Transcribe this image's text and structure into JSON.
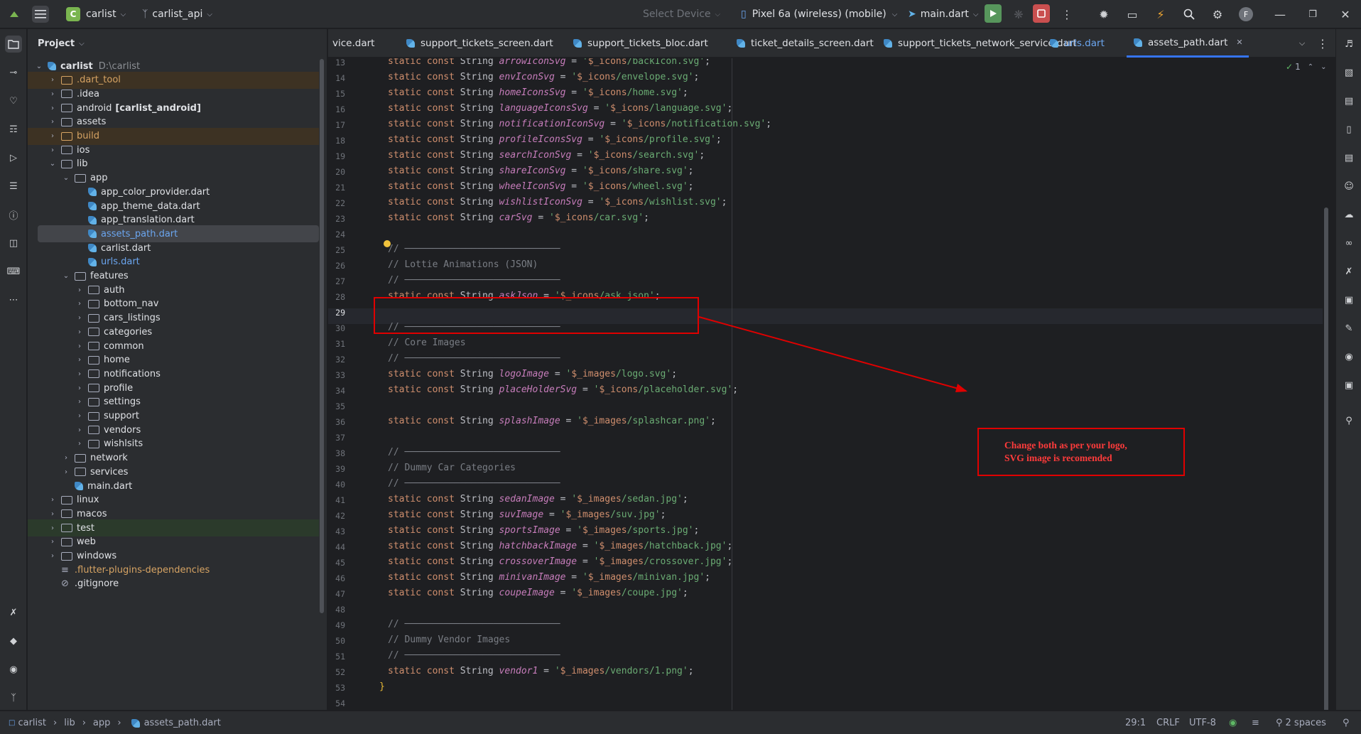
{
  "titlebar": {
    "project_badge": "C",
    "project_name": "carlist",
    "vcs_branch": "carlist_api",
    "select_device": "Select Device",
    "device": "Pixel 6a (wireless) (mobile)",
    "run_config": "main.dart",
    "avatar_letter": "F"
  },
  "project_panel": {
    "title": "Project",
    "tree": [
      {
        "label": "carlist",
        "extra": "D:\\carlist",
        "depth": 0,
        "kind": "module",
        "open": true
      },
      {
        "label": ".dart_tool",
        "depth": 1,
        "kind": "folder",
        "color": "orange",
        "hl": "orange"
      },
      {
        "label": ".idea",
        "depth": 1,
        "kind": "folder"
      },
      {
        "label": "android",
        "extra": "[carlist_android]",
        "depth": 1,
        "kind": "folder"
      },
      {
        "label": "assets",
        "depth": 1,
        "kind": "folder"
      },
      {
        "label": "build",
        "depth": 1,
        "kind": "folder",
        "color": "orange",
        "hl": "orange"
      },
      {
        "label": "ios",
        "depth": 1,
        "kind": "folder"
      },
      {
        "label": "lib",
        "depth": 1,
        "kind": "folder",
        "open": true
      },
      {
        "label": "app",
        "depth": 2,
        "kind": "folder",
        "open": true
      },
      {
        "label": "app_color_provider.dart",
        "depth": 3,
        "kind": "dart"
      },
      {
        "label": "app_theme_data.dart",
        "depth": 3,
        "kind": "dart"
      },
      {
        "label": "app_translation.dart",
        "depth": 3,
        "kind": "dart"
      },
      {
        "label": "assets_path.dart",
        "depth": 3,
        "kind": "dart",
        "color": "blue",
        "selected": true
      },
      {
        "label": "carlist.dart",
        "depth": 3,
        "kind": "dart"
      },
      {
        "label": "urls.dart",
        "depth": 3,
        "kind": "dart",
        "color": "blue"
      },
      {
        "label": "features",
        "depth": 2,
        "kind": "folder",
        "open": true
      },
      {
        "label": "auth",
        "depth": 3,
        "kind": "folder"
      },
      {
        "label": "bottom_nav",
        "depth": 3,
        "kind": "folder"
      },
      {
        "label": "cars_listings",
        "depth": 3,
        "kind": "folder"
      },
      {
        "label": "categories",
        "depth": 3,
        "kind": "folder"
      },
      {
        "label": "common",
        "depth": 3,
        "kind": "folder"
      },
      {
        "label": "home",
        "depth": 3,
        "kind": "folder"
      },
      {
        "label": "notifications",
        "depth": 3,
        "kind": "folder"
      },
      {
        "label": "profile",
        "depth": 3,
        "kind": "folder"
      },
      {
        "label": "settings",
        "depth": 3,
        "kind": "folder"
      },
      {
        "label": "support",
        "depth": 3,
        "kind": "folder"
      },
      {
        "label": "vendors",
        "depth": 3,
        "kind": "folder"
      },
      {
        "label": "wishlsits",
        "depth": 3,
        "kind": "folder"
      },
      {
        "label": "network",
        "depth": 2,
        "kind": "folder"
      },
      {
        "label": "services",
        "depth": 2,
        "kind": "folder"
      },
      {
        "label": "main.dart",
        "depth": 2,
        "kind": "dart"
      },
      {
        "label": "linux",
        "depth": 1,
        "kind": "folder"
      },
      {
        "label": "macos",
        "depth": 1,
        "kind": "folder"
      },
      {
        "label": "test",
        "depth": 1,
        "kind": "folder",
        "hl": "green"
      },
      {
        "label": "web",
        "depth": 1,
        "kind": "folder"
      },
      {
        "label": "windows",
        "depth": 1,
        "kind": "folder"
      },
      {
        "label": ".flutter-plugins-dependencies",
        "depth": 1,
        "kind": "file",
        "color": "orange"
      },
      {
        "label": ".gitignore",
        "depth": 1,
        "kind": "ignore"
      }
    ]
  },
  "tabs": [
    {
      "label": "vice.dart",
      "icon": false
    },
    {
      "label": "support_tickets_screen.dart",
      "icon": true
    },
    {
      "label": "support_tickets_bloc.dart",
      "icon": true
    },
    {
      "label": "ticket_details_screen.dart",
      "icon": true
    },
    {
      "label": "support_tickets_network_service.dart",
      "icon": true
    },
    {
      "label": "urls.dart",
      "icon": true,
      "color": "blue"
    },
    {
      "label": "assets_path.dart",
      "icon": true,
      "active": true,
      "closable": true
    }
  ],
  "editor": {
    "inspection_count": "1",
    "current_line": 29,
    "lines": [
      {
        "n": 13,
        "t": "const",
        "name": "arrowIconSvg",
        "pre": "$_icons",
        "path": "/backIcon.svg"
      },
      {
        "n": 14,
        "t": "const",
        "name": "envIconSvg",
        "pre": "$_icons",
        "path": "/envelope.svg"
      },
      {
        "n": 15,
        "t": "const",
        "name": "homeIconsSvg",
        "pre": "$_icons",
        "path": "/home.svg"
      },
      {
        "n": 16,
        "t": "const",
        "name": "languageIconsSvg",
        "pre": "$_icons",
        "path": "/language.svg"
      },
      {
        "n": 17,
        "t": "const",
        "name": "notificationIconSvg",
        "pre": "$_icons",
        "path": "/notification.svg"
      },
      {
        "n": 18,
        "t": "const",
        "name": "profileIconsSvg",
        "pre": "$_icons",
        "path": "/profile.svg"
      },
      {
        "n": 19,
        "t": "const",
        "name": "searchIconSvg",
        "pre": "$_icons",
        "path": "/search.svg"
      },
      {
        "n": 20,
        "t": "const",
        "name": "shareIconSvg",
        "pre": "$_icons",
        "path": "/share.svg"
      },
      {
        "n": 21,
        "t": "const",
        "name": "wheelIconSvg",
        "pre": "$_icons",
        "path": "/wheel.svg"
      },
      {
        "n": 22,
        "t": "const",
        "name": "wishlistIconSvg",
        "pre": "$_icons",
        "path": "/wishlist.svg"
      },
      {
        "n": 23,
        "t": "const",
        "name": "carSvg",
        "pre": "$_icons",
        "path": "/car.svg"
      },
      {
        "n": 24,
        "t": "blank"
      },
      {
        "n": 25,
        "t": "rule"
      },
      {
        "n": 26,
        "t": "comment",
        "text": "// Lottie Animations (JSON)"
      },
      {
        "n": 27,
        "t": "rule"
      },
      {
        "n": 28,
        "t": "const",
        "name": "askJson",
        "pre": "$_icons",
        "path": "/ask.json"
      },
      {
        "n": 29,
        "t": "blank"
      },
      {
        "n": 30,
        "t": "rule"
      },
      {
        "n": 31,
        "t": "comment",
        "text": "// Core Images"
      },
      {
        "n": 32,
        "t": "rule"
      },
      {
        "n": 33,
        "t": "const",
        "name": "logoImage",
        "pre": "$_images",
        "path": "/logo.svg"
      },
      {
        "n": 34,
        "t": "const",
        "name": "placeHolderSvg",
        "pre": "$_icons",
        "path": "/placeholder.svg"
      },
      {
        "n": 35,
        "t": "blank"
      },
      {
        "n": 36,
        "t": "const",
        "name": "splashImage",
        "pre": "$_images",
        "path": "/splashcar.png"
      },
      {
        "n": 37,
        "t": "blank"
      },
      {
        "n": 38,
        "t": "rule"
      },
      {
        "n": 39,
        "t": "comment",
        "text": "// Dummy Car Categories"
      },
      {
        "n": 40,
        "t": "rule"
      },
      {
        "n": 41,
        "t": "const",
        "name": "sedanImage",
        "pre": "$_images",
        "path": "/sedan.jpg"
      },
      {
        "n": 42,
        "t": "const",
        "name": "suvImage",
        "pre": "$_images",
        "path": "/suv.jpg"
      },
      {
        "n": 43,
        "t": "const",
        "name": "sportsImage",
        "pre": "$_images",
        "path": "/sports.jpg"
      },
      {
        "n": 44,
        "t": "const",
        "name": "hatchbackImage",
        "pre": "$_images",
        "path": "/hatchback.jpg"
      },
      {
        "n": 45,
        "t": "const",
        "name": "crossoverImage",
        "pre": "$_images",
        "path": "/crossover.jpg"
      },
      {
        "n": 46,
        "t": "const",
        "name": "minivanImage",
        "pre": "$_images",
        "path": "/minivan.jpg"
      },
      {
        "n": 47,
        "t": "const",
        "name": "coupeImage",
        "pre": "$_images",
        "path": "/coupe.jpg"
      },
      {
        "n": 48,
        "t": "blank"
      },
      {
        "n": 49,
        "t": "rule"
      },
      {
        "n": 50,
        "t": "comment",
        "text": "// Dummy Vendor Images"
      },
      {
        "n": 51,
        "t": "rule"
      },
      {
        "n": 52,
        "t": "const",
        "name": "vendor1",
        "pre": "$_images",
        "path": "/vendors/1.png"
      },
      {
        "n": 53,
        "t": "brace",
        "text": "}"
      },
      {
        "n": 54,
        "t": "blank"
      }
    ],
    "keywords": {
      "static": "static",
      "const": "const",
      "type": "String",
      "comment_prefix": "//"
    },
    "annotation": {
      "line1": "Change both as per your logo,",
      "line2": "SVG image is recomended"
    }
  },
  "statusbar": {
    "breadcrumb": [
      "carlist",
      "lib",
      "app",
      "assets_path.dart"
    ],
    "position": "29:1",
    "line_sep": "CRLF",
    "encoding": "UTF-8",
    "indent": "2 spaces"
  },
  "colors": {
    "accent": "#3574f0",
    "annotation_red": "#e00000",
    "run_green": "#57965c",
    "stop_red": "#c94f4f"
  }
}
